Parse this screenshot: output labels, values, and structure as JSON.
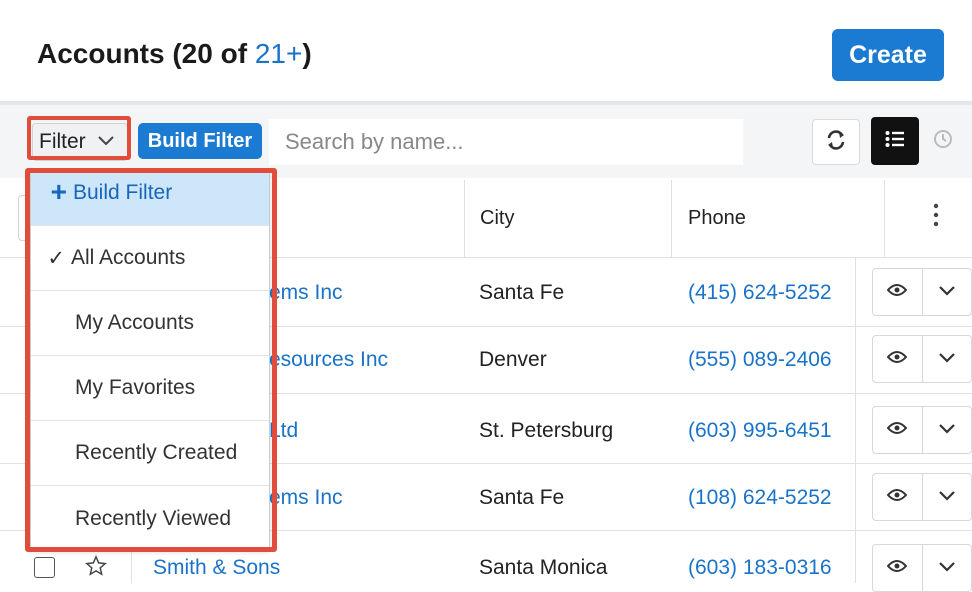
{
  "header": {
    "title_prefix": "Accounts (20 of ",
    "title_count": "21+",
    "title_suffix": ")",
    "create_label": "Create"
  },
  "toolbar": {
    "filter_label": "Filter",
    "build_filter_label": "Build Filter",
    "search_placeholder": "Search by name...",
    "refresh_icon": "refresh-icon",
    "list_view_icon": "list-view-icon",
    "activity_icon": "clock-icon"
  },
  "table": {
    "columns": {
      "city": "City",
      "phone": "Phone"
    },
    "rows": [
      {
        "name": "ems Inc",
        "city": "Santa Fe",
        "phone": "(415) 624-5252"
      },
      {
        "name": "esources Inc",
        "city": "Denver",
        "phone": "(555) 089-2406"
      },
      {
        "name": "Ltd",
        "city": "St. Petersburg",
        "phone": "(603) 995-6451"
      },
      {
        "name": "ems Inc",
        "city": "Santa Fe",
        "phone": "(108) 624-5252"
      },
      {
        "name": "Smith & Sons",
        "city": "Santa Monica",
        "phone": "(603) 183-0316"
      }
    ]
  },
  "filter_menu": {
    "items": [
      {
        "label": "Build Filter",
        "icon": "plus-icon",
        "selected": false
      },
      {
        "label": "All Accounts",
        "icon": "check-icon",
        "selected": true
      },
      {
        "label": "My Accounts",
        "selected": false
      },
      {
        "label": "My Favorites",
        "selected": false
      },
      {
        "label": "Recently Created",
        "selected": false
      },
      {
        "label": "Recently Viewed",
        "selected": false
      }
    ]
  },
  "colors": {
    "accent": "#1b7ad1",
    "link": "#1a73c8",
    "highlight": "#e04d3a",
    "menu_active_bg": "#cde6fa"
  }
}
